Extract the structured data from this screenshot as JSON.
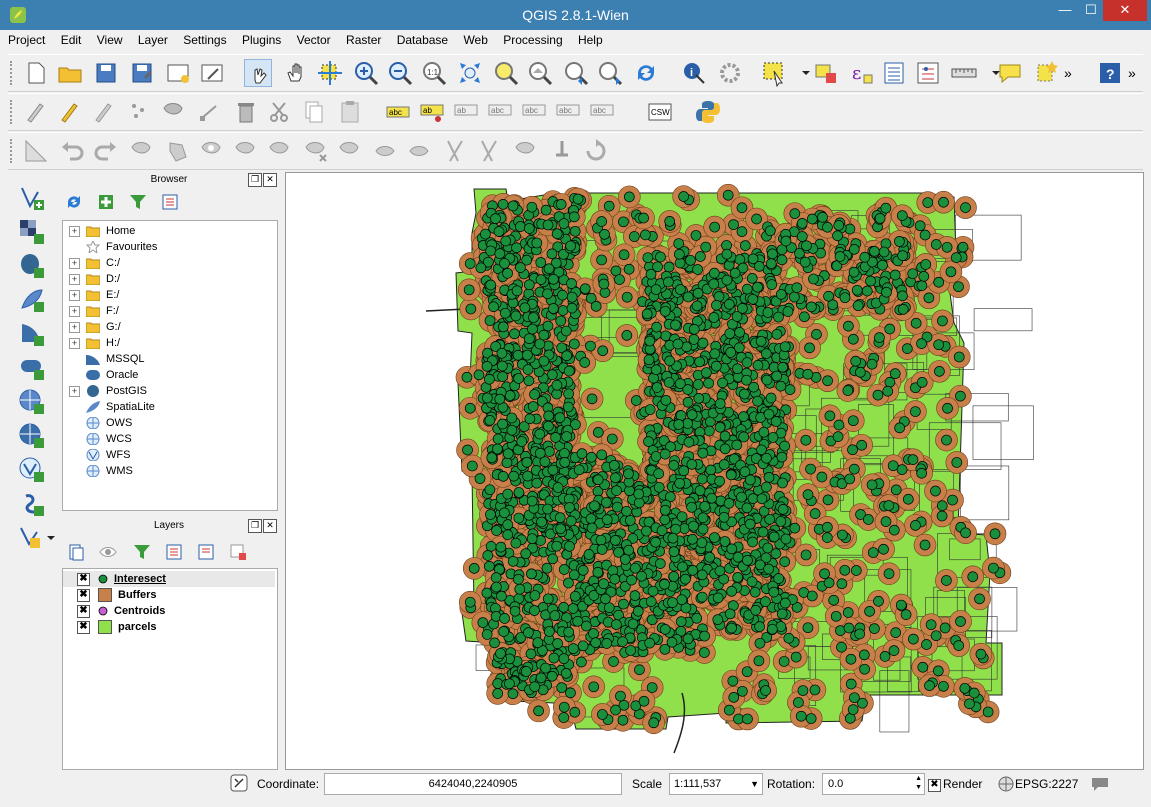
{
  "window": {
    "title": "QGIS 2.8.1-Wien",
    "min": "—",
    "max": "☐",
    "close": "✕"
  },
  "menu": [
    "Project",
    "Edit",
    "View",
    "Layer",
    "Settings",
    "Plugins",
    "Vector",
    "Raster",
    "Database",
    "Web",
    "Processing",
    "Help"
  ],
  "toolbar_more": "»",
  "browser": {
    "title": "Browser",
    "items": [
      {
        "label": "Home",
        "icon": "folder-icon",
        "expandable": true
      },
      {
        "label": "Favourites",
        "icon": "star-icon",
        "expandable": false
      },
      {
        "label": "C:/",
        "icon": "folder-icon",
        "expandable": true
      },
      {
        "label": "D:/",
        "icon": "folder-icon",
        "expandable": true
      },
      {
        "label": "E:/",
        "icon": "folder-icon",
        "expandable": true
      },
      {
        "label": "F:/",
        "icon": "folder-icon",
        "expandable": true
      },
      {
        "label": "G:/",
        "icon": "folder-icon",
        "expandable": true
      },
      {
        "label": "H:/",
        "icon": "folder-icon",
        "expandable": true
      },
      {
        "label": "MSSQL",
        "icon": "mssql-icon",
        "expandable": false
      },
      {
        "label": "Oracle",
        "icon": "oracle-icon",
        "expandable": false
      },
      {
        "label": "PostGIS",
        "icon": "postgis-icon",
        "expandable": true
      },
      {
        "label": "SpatiaLite",
        "icon": "spatialite-icon",
        "expandable": false
      },
      {
        "label": "OWS",
        "icon": "globe-icon",
        "expandable": false
      },
      {
        "label": "WCS",
        "icon": "globe-icon",
        "expandable": false
      },
      {
        "label": "WFS",
        "icon": "globe-icon",
        "expandable": false
      },
      {
        "label": "WMS",
        "icon": "globe-icon",
        "expandable": false
      }
    ]
  },
  "layers": {
    "title": "Layers",
    "items": [
      {
        "label": "Interesect",
        "symbol": "point",
        "color": "#1a8f3c",
        "checked": "✖",
        "selected": true
      },
      {
        "label": "Buffers",
        "symbol": "polygon",
        "color": "#c8804a",
        "checked": "✖"
      },
      {
        "label": "Centroids",
        "symbol": "point",
        "color": "#c65fd0",
        "checked": "✖"
      },
      {
        "label": "parcels",
        "symbol": "polygon",
        "color": "#8fe04a",
        "checked": "✖"
      }
    ]
  },
  "status": {
    "coordinate_label": "Coordinate:",
    "coordinate_value": "6424040,2240905",
    "scale_label": "Scale",
    "scale_value": "1:111,537",
    "rotation_label": "Rotation:",
    "rotation_value": "0.0",
    "render_label": "Render",
    "render_checked": "✖",
    "crs": "EPSG:2227"
  },
  "colors": {
    "parcel_fill": "#8fe04a",
    "buffer_fill": "#c8804a",
    "point_fill": "#1a8f3c",
    "titlebar": "#3c7fb1"
  }
}
